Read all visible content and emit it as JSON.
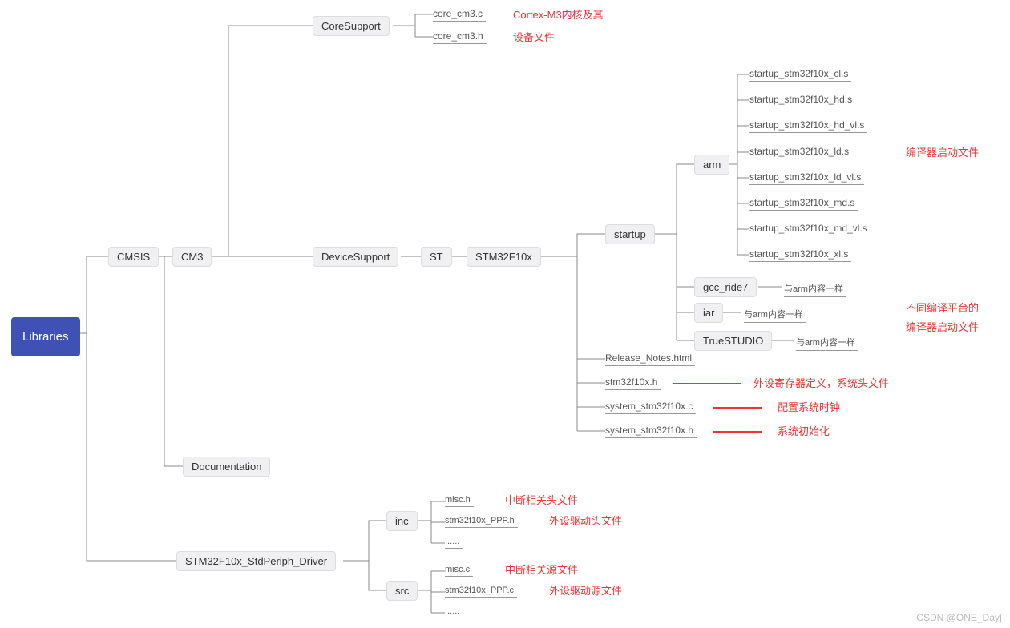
{
  "root": {
    "label": "Libraries"
  },
  "cmsis": {
    "label": "CMSIS"
  },
  "cm3": {
    "label": "CM3"
  },
  "coresupport": {
    "label": "CoreSupport"
  },
  "devicesupport": {
    "label": "DeviceSupport"
  },
  "st": {
    "label": "ST"
  },
  "stm32f10x": {
    "label": "STM32F10x"
  },
  "startup": {
    "label": "startup"
  },
  "arm": {
    "label": "arm"
  },
  "gcc": {
    "label": "gcc_ride7"
  },
  "iar": {
    "label": "iar"
  },
  "truestudio": {
    "label": "TrueSTUDIO"
  },
  "documentation": {
    "label": "Documentation"
  },
  "stdperiph": {
    "label": "STM32F10x_StdPeriph_Driver"
  },
  "inc": {
    "label": "inc"
  },
  "src": {
    "label": "src"
  },
  "core_files": {
    "c": "core_cm3.c",
    "h": "core_cm3.h"
  },
  "arm_files": {
    "f0": "startup_stm32f10x_cl.s",
    "f1": "startup_stm32f10x_hd.s",
    "f2": "startup_stm32f10x_hd_vl.s",
    "f3": "startup_stm32f10x_ld.s",
    "f4": "startup_stm32f10x_ld_vl.s",
    "f5": "startup_stm32f10x_md.s",
    "f6": "startup_stm32f10x_md_vl.s",
    "f7": "startup_stm32f10x_xl.s"
  },
  "same_as_arm": "与arm内容一样",
  "stm32_files": {
    "release": "Release_Notes.html",
    "h": "stm32f10x.h",
    "sysc": "system_stm32f10x.c",
    "sysh": "system_stm32f10x.h"
  },
  "inc_files": {
    "misc": "misc.h",
    "ppp": "stm32f10x_PPP.h",
    "dots": "......"
  },
  "src_files": {
    "misc": "misc.c",
    "ppp": "stm32f10x_PPP.c",
    "dots": "......"
  },
  "ann": {
    "core1": "Cortex-M3内核及其",
    "core2": "设备文件",
    "compiler_startup": "编译器启动文件",
    "diff1": "不同编译平台的",
    "diff2": "编译器启动文件",
    "reg_def": "外设寄存器定义，系统头文件",
    "sys_clock": "配置系统时钟",
    "sys_init": "系统初始化",
    "inc_misc": "中断相关头文件",
    "inc_ppp": "外设驱动头文件",
    "src_misc": "中断相关源文件",
    "src_ppp": "外设驱动源文件"
  },
  "watermark": "CSDN @ONE_Day|"
}
